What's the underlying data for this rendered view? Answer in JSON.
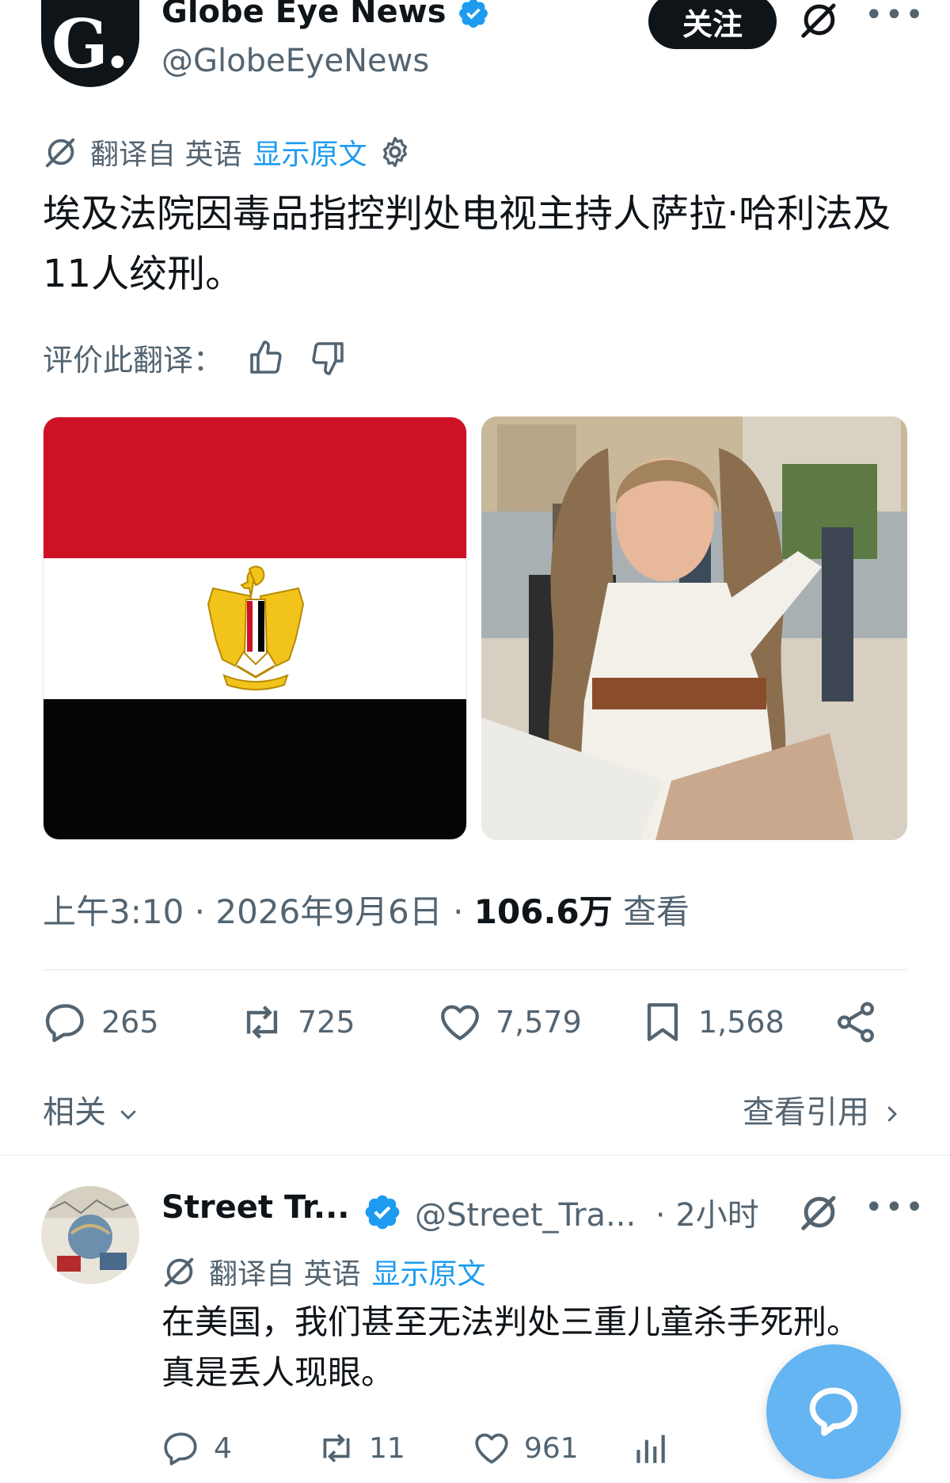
{
  "post": {
    "author": {
      "logo_letter": "G.",
      "name": "Globe Eye News",
      "handle": "@GlobeEyeNews"
    },
    "follow_label": "关注",
    "more_label": "•••",
    "translation": {
      "source_label": "翻译自 英语",
      "show_original": "显示原文"
    },
    "text": "埃及法院因毒品指控判处电视主持人萨拉·哈利法及11人绞刑。",
    "rate_label": "评价此翻译：",
    "meta": {
      "time": "上午3:10",
      "sep1": " · ",
      "date": "2026年9月6日",
      "sep2": " · ",
      "views": "106.6万",
      "views_label": " 查看"
    },
    "stats": {
      "replies": "265",
      "reposts": "725",
      "likes": "7,579",
      "bookmarks": "1,568"
    },
    "related_label": "相关",
    "quotes_label": "查看引用"
  },
  "reply": {
    "name": "Street Tr...",
    "handle": "@Street_Tra...",
    "time": "· 2小时",
    "more_label": "•••",
    "translation": {
      "source_label": "翻译自 英语",
      "show_original": "显示原文"
    },
    "text": "在美国，我们甚至无法判处三重儿童杀手死刑。真是丢人现眼。",
    "stats": {
      "replies": "4",
      "reposts": "11",
      "likes": "961"
    }
  },
  "colors": {
    "accent": "#1d9bf0",
    "text": "#0f1419",
    "muted": "#536471",
    "flag_red": "#cf1126",
    "flag_black": "#050505",
    "eagle_gold": "#f2c31a",
    "fab": "#64b5f2"
  },
  "icons": [
    "verified-badge-icon",
    "grok-icon",
    "translate-icon",
    "gear-icon",
    "thumbs-up-icon",
    "thumbs-down-icon",
    "reply-icon",
    "repost-icon",
    "like-icon",
    "bookmark-icon",
    "share-icon",
    "chevron-down-icon",
    "chevron-right-icon",
    "analytics-icon",
    "compose-icon"
  ]
}
